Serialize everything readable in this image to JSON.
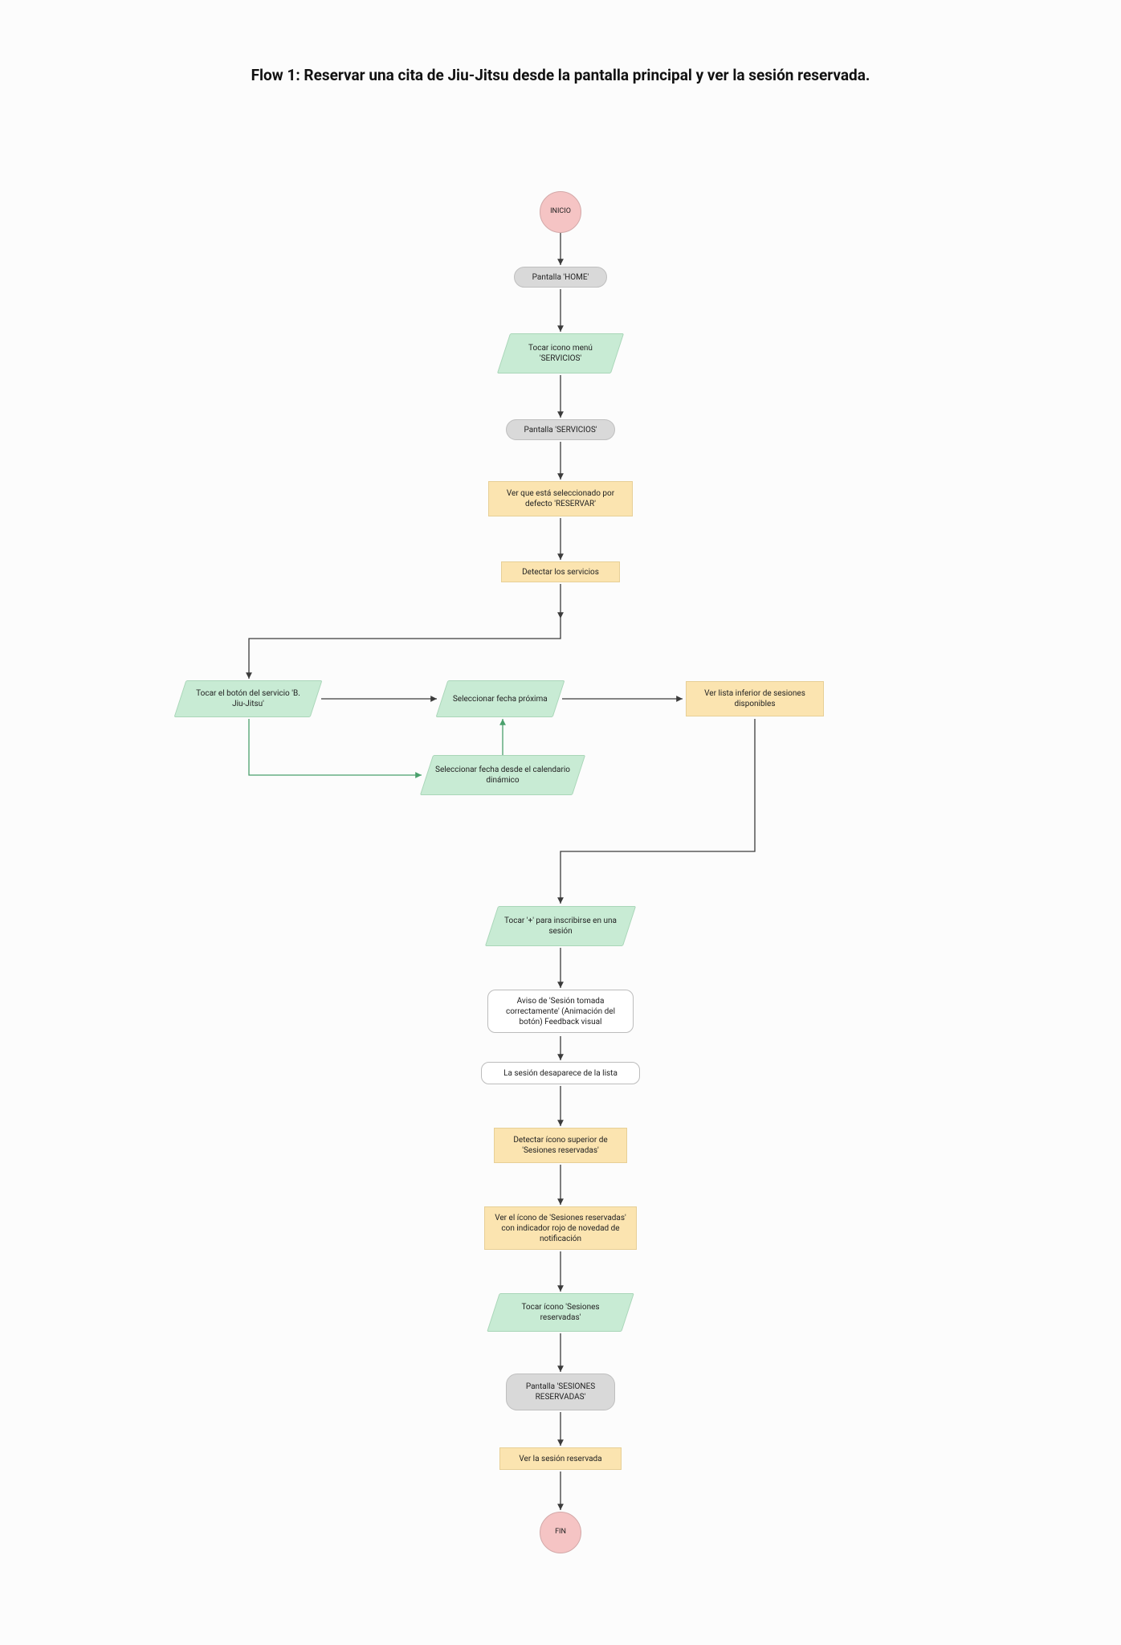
{
  "title": "Flow 1: Reservar una cita de Jiu-Jitsu desde la pantalla principal y ver la sesión reservada.",
  "nodes": {
    "start": "INICIO",
    "home": "Pantalla 'HOME'",
    "tap_servicios": "Tocar icono menú 'SERVICIOS'",
    "screen_servicios": "Pantalla 'SERVICIOS'",
    "default_reservar": "Ver que está seleccionado por defecto 'RESERVAR'",
    "detect_services": "Detectar los servicios",
    "tap_jiujitsu": "Tocar el botón del servicio 'B. Jiu-Jitsu'",
    "select_next_date": "Seleccionar fecha próxima",
    "select_calendar_date": "Seleccionar fecha desde el calendario dinámico",
    "see_sessions_list": "Ver lista inferior de sesiones disponibles",
    "tap_plus": "Tocar '+' para inscribirse en una sesión",
    "feedback_toast": "Aviso de 'Sesión tomada correctamente' (Animación del botón) Feedback visual",
    "disappears": "La sesión desaparece de la lista",
    "detect_icon": "Detectar ícono superior de 'Sesiones reservadas'",
    "see_badge": "Ver el ícono de 'Sesiones reservadas' con indicador rojo de novedad de notificación",
    "tap_reserved": "Tocar ícono 'Sesiones reservadas'",
    "screen_reserved": "Pantalla 'SESIONES RESERVADAS'",
    "see_reserved": "Ver la sesión reservada",
    "end": "FIN"
  }
}
